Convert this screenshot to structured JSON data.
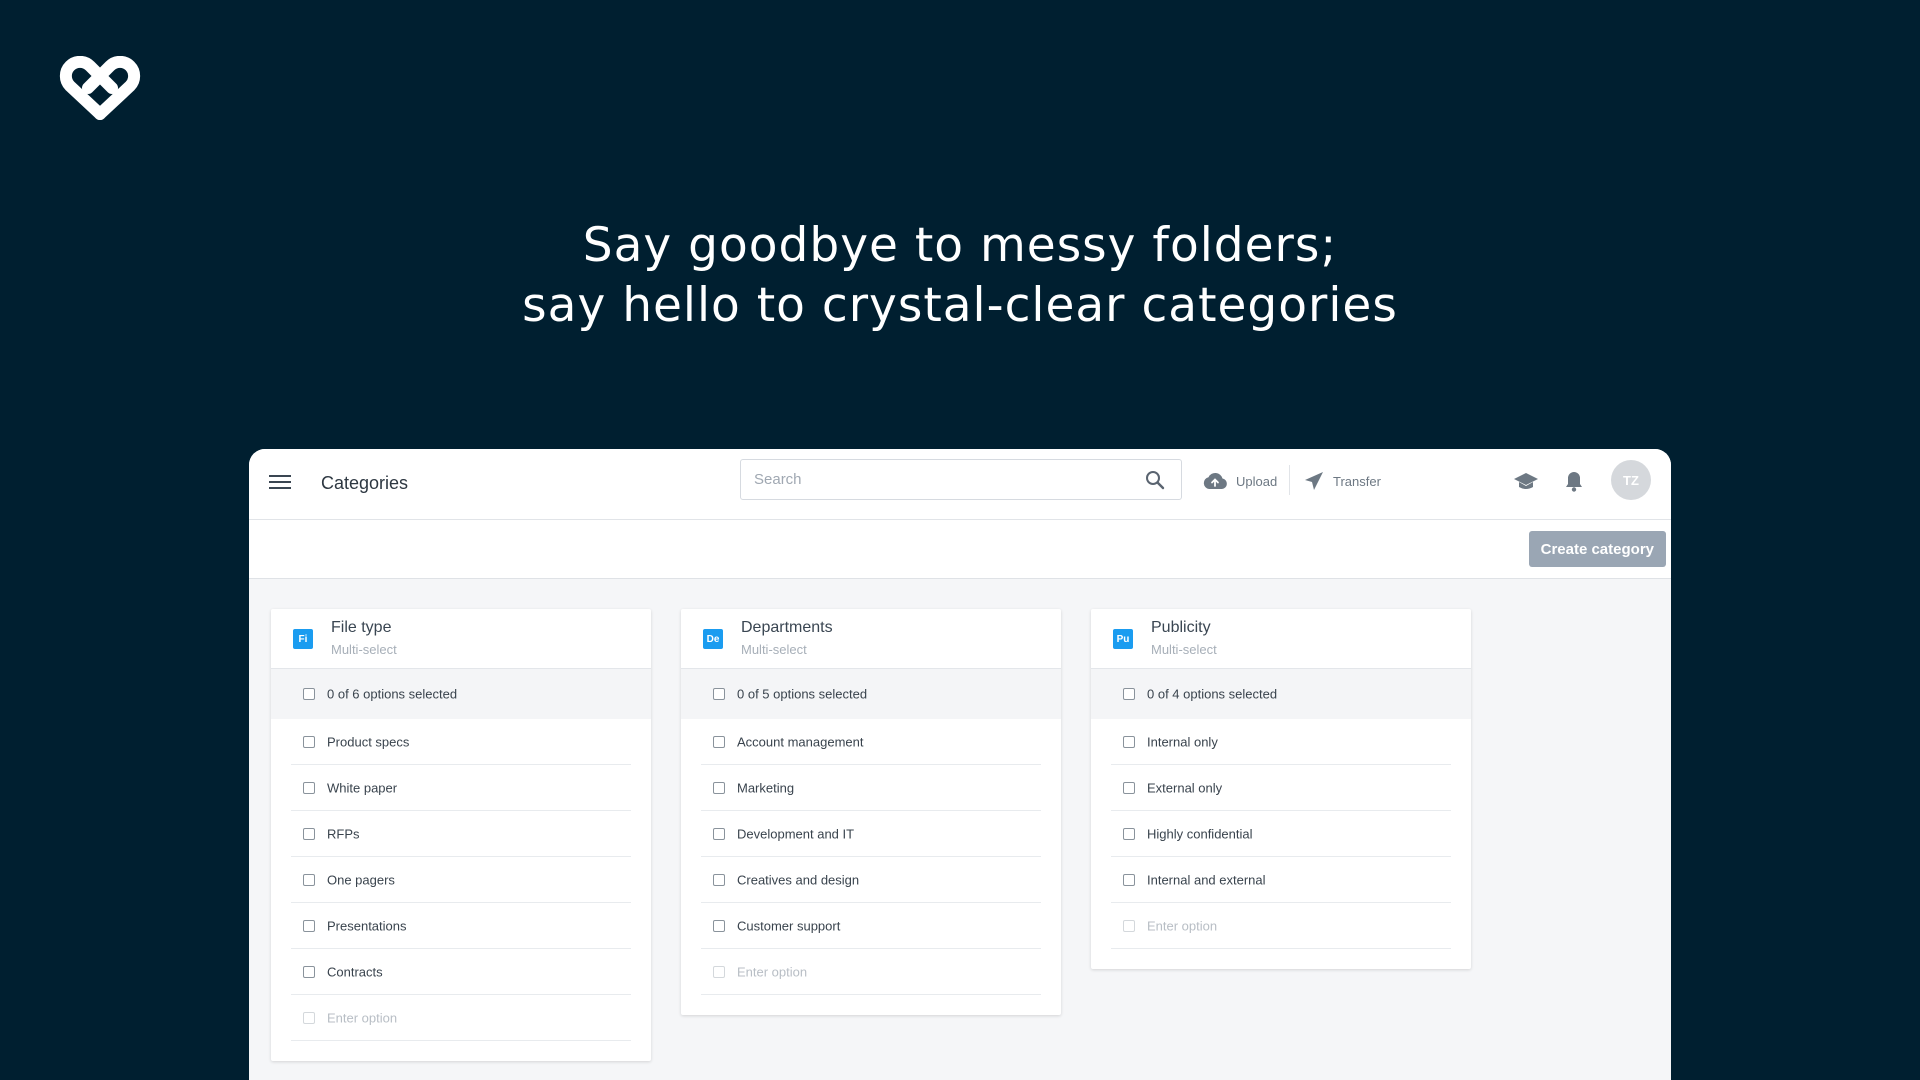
{
  "headline": {
    "line1": "Say goodbye to messy folders;",
    "line2": "say hello to crystal-clear categories"
  },
  "topbar": {
    "title": "Categories",
    "search_placeholder": "Search",
    "upload_label": "Upload",
    "transfer_label": "Transfer",
    "avatar_initials": "TZ"
  },
  "toolbar": {
    "create_label": "Create category"
  },
  "colors": {
    "background": "#001f30",
    "badge": "#1a9cf0",
    "button": "#9aa6b4"
  },
  "cards": [
    {
      "badge": "Fi",
      "title": "File type",
      "subtitle": "Multi-select",
      "summary": "0 of 6 options selected",
      "options": [
        "Product specs",
        "White paper",
        "RFPs",
        "One pagers",
        "Presentations",
        "Contracts"
      ],
      "placeholder": "Enter option"
    },
    {
      "badge": "De",
      "title": "Departments",
      "subtitle": "Multi-select",
      "summary": "0 of 5 options selected",
      "options": [
        "Account management",
        "Marketing",
        "Development and IT",
        "Creatives and design",
        "Customer support"
      ],
      "placeholder": "Enter option"
    },
    {
      "badge": "Pu",
      "title": "Publicity",
      "subtitle": "Multi-select",
      "summary": "0 of 4 options selected",
      "options": [
        "Internal only",
        "External only",
        "Highly confidential",
        "Internal and external"
      ],
      "placeholder": "Enter option"
    }
  ]
}
